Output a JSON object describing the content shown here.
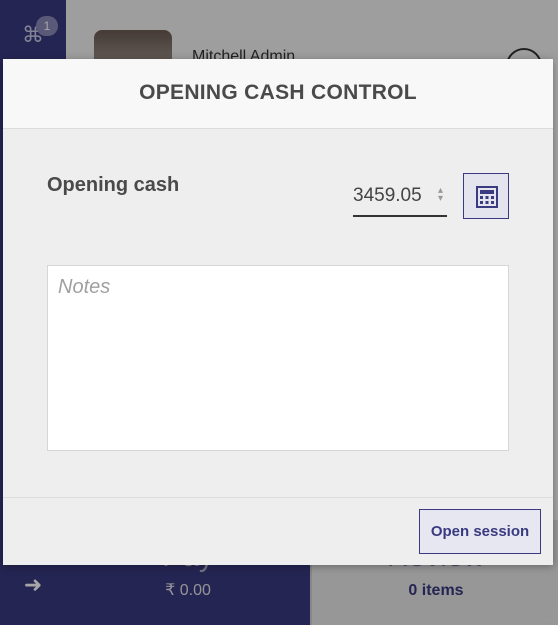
{
  "background": {
    "sidebar": {
      "ticket_badge": "1",
      "ticket_icon": "ticket-icon",
      "logout_icon": "sign-out-icon"
    },
    "header": {
      "user_name": "Mitchell Admin"
    },
    "pay": {
      "label": "Pay",
      "amount": "₹ 0.00"
    },
    "review": {
      "label": "Review",
      "items": "0 items"
    }
  },
  "modal": {
    "title": "OPENING CASH CONTROL",
    "opening_cash_label": "Opening cash",
    "opening_cash_value": "3459.05",
    "notes_placeholder": "Notes",
    "open_session_label": "Open session",
    "calculator_icon": "calculator-icon"
  },
  "colors": {
    "accent": "#3a3a80",
    "modal_bg": "#efeeef"
  }
}
